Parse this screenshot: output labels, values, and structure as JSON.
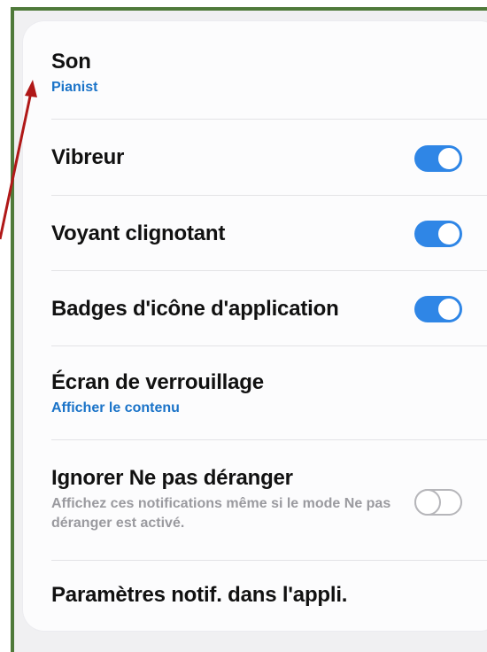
{
  "settings": {
    "sound": {
      "label": "Son",
      "value": "Pianist"
    },
    "vibrate": {
      "label": "Vibreur",
      "enabled": true
    },
    "blink_light": {
      "label": "Voyant clignotant",
      "enabled": true
    },
    "app_icon_badges": {
      "label": "Badges d'icône d'application",
      "enabled": true
    },
    "lock_screen": {
      "label": "Écran de verrouillage",
      "value": "Afficher le contenu"
    },
    "ignore_dnd": {
      "label": "Ignorer Ne pas déranger",
      "description": "Affichez ces notifications même si le mode Ne pas déranger est activé.",
      "enabled": false
    },
    "in_app_settings": {
      "label": "Paramètres notif. dans l'appli."
    }
  },
  "colors": {
    "accent": "#2f86e6",
    "link_blue": "#1a73c8",
    "frame_green": "#4f7a3a",
    "annotation_arrow": "#b01818"
  }
}
